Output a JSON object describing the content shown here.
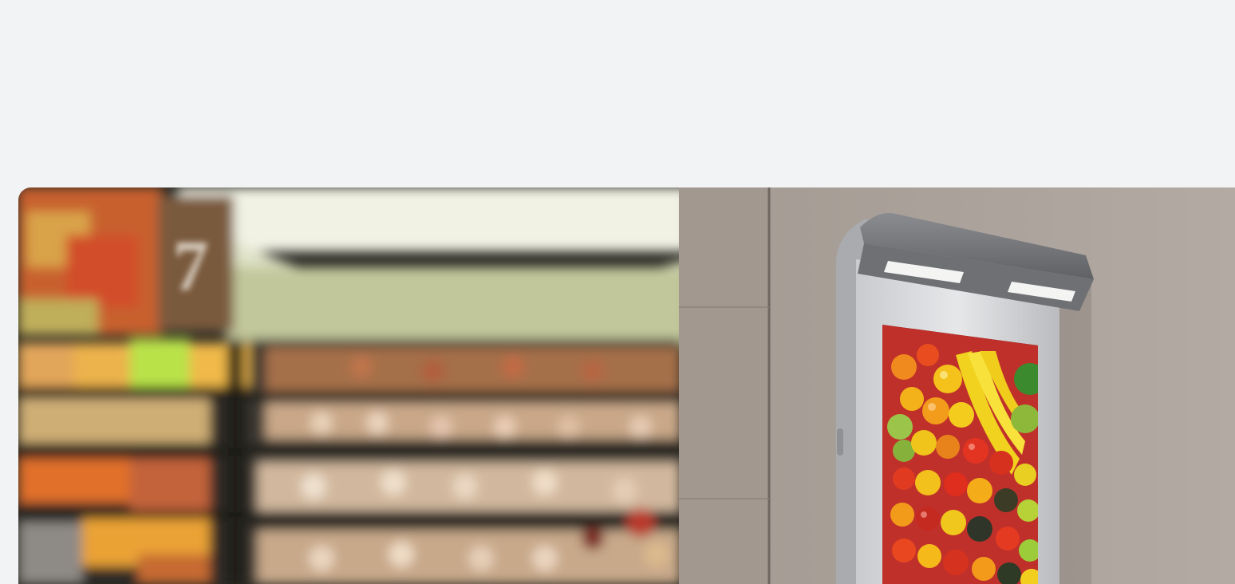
{
  "page": {
    "background_color": "#f2f3f5"
  },
  "hero": {
    "image_name": "wall-mounted-digital-signage-in-grocery-store",
    "left_scene": "blurred-supermarket-shelves",
    "right_scene": "signage-display-showing-fruit",
    "store_sign_number": "7"
  }
}
